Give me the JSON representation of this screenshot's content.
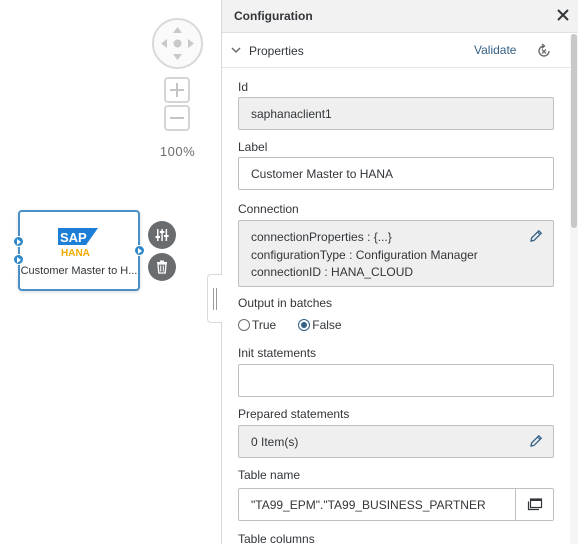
{
  "canvas": {
    "zoom_level": "100%",
    "node": {
      "logo_text": "SAP",
      "logo_subtext": "HANA",
      "label": "Customer Master to H..."
    }
  },
  "panel": {
    "title": "Configuration",
    "section": {
      "title": "Properties",
      "validate_label": "Validate"
    },
    "fields": {
      "id_label": "Id",
      "id_value": "saphanaclient1",
      "label_label": "Label",
      "label_value": "Customer Master to HANA",
      "connection_label": "Connection",
      "connection_lines": [
        "connectionProperties : {...}",
        "configurationType : Configuration Manager",
        "connectionID : HANA_CLOUD"
      ],
      "batches_label": "Output in batches",
      "batches_options": [
        "True",
        "False"
      ],
      "batches_selected": "False",
      "init_label": "Init statements",
      "init_value": "",
      "prepared_label": "Prepared statements",
      "prepared_value": "0 Item(s)",
      "table_name_label": "Table name",
      "table_name_value": "\"TA99_EPM\".\"TA99_BUSINESS_PARTNER",
      "table_columns_label": "Table columns"
    }
  },
  "colors": {
    "accent": "#346187",
    "node_border": "#4a90c8",
    "port": "#2f88c9",
    "sap_blue": "#1c7ed6",
    "hana_gold": "#f0ab00"
  }
}
